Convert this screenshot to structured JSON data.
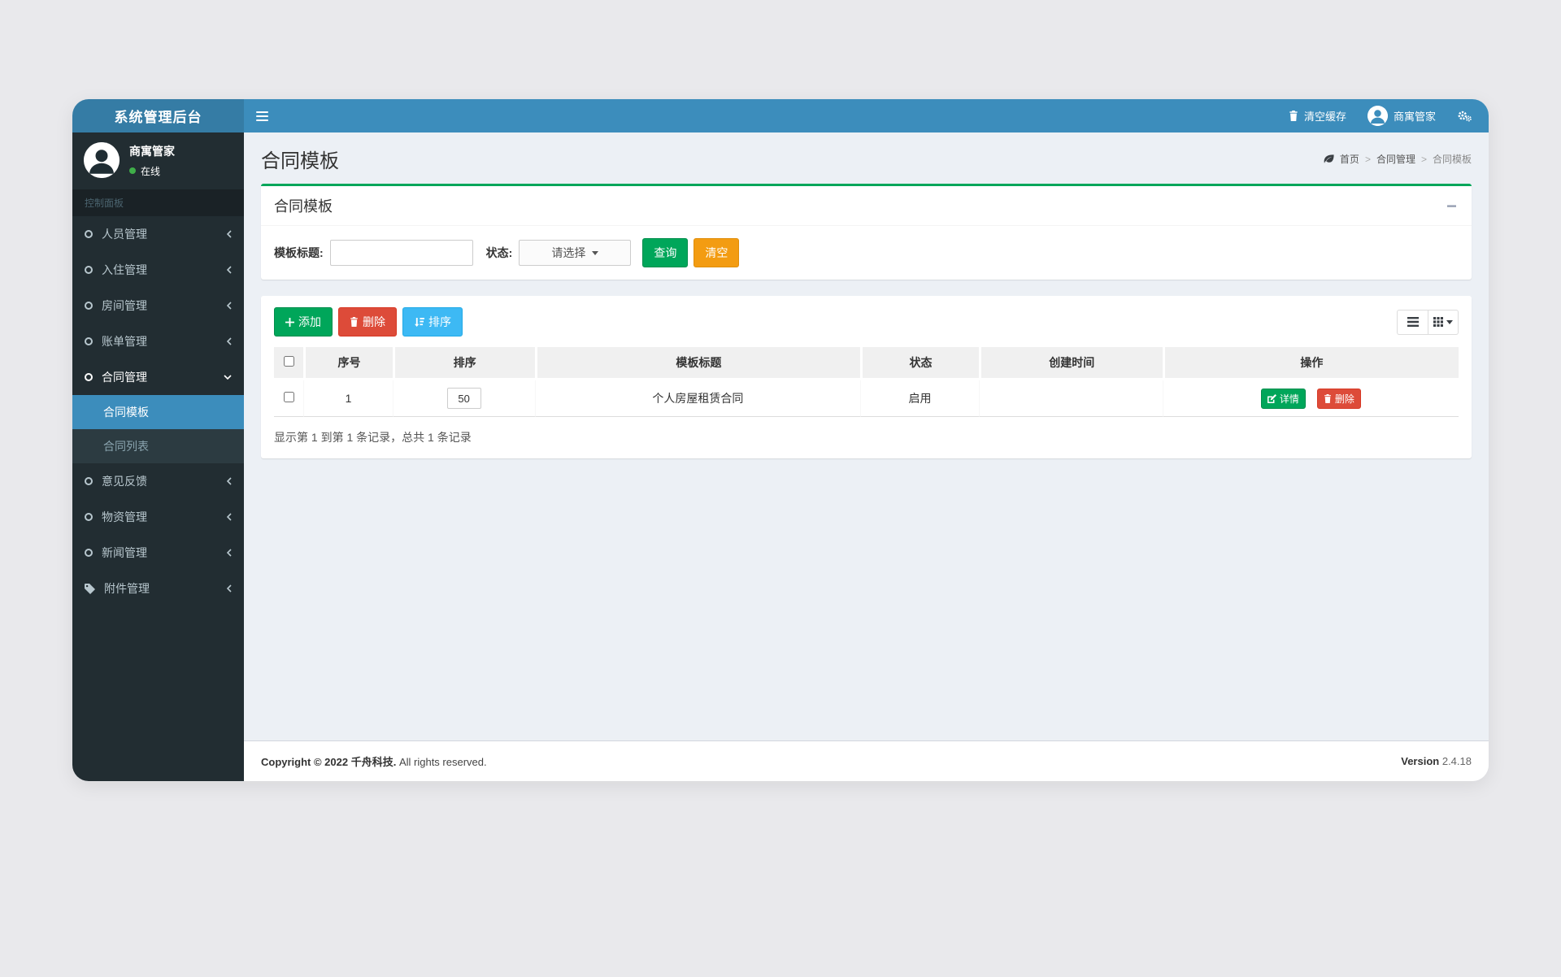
{
  "app": {
    "logo_title": "系统管理后台"
  },
  "navbar": {
    "clear_cache": "清空缓存",
    "user_name": "商寓管家"
  },
  "sidebar": {
    "user_name": "商寓管家",
    "user_status": "在线",
    "section_header": "控制面板",
    "items": [
      {
        "label": "人员管理",
        "icon": "circle-o-icon"
      },
      {
        "label": "入住管理",
        "icon": "circle-o-icon"
      },
      {
        "label": "房间管理",
        "icon": "circle-o-icon"
      },
      {
        "label": "账单管理",
        "icon": "circle-o-icon"
      },
      {
        "label": "合同管理",
        "icon": "circle-o-icon",
        "state": "expanded"
      },
      {
        "label": "意见反馈",
        "icon": "circle-o-icon"
      },
      {
        "label": "物资管理",
        "icon": "circle-o-icon"
      },
      {
        "label": "新闻管理",
        "icon": "circle-o-icon"
      },
      {
        "label": "附件管理",
        "icon": "tag-icon"
      }
    ],
    "submenu": [
      {
        "label": "合同模板",
        "active": true
      },
      {
        "label": "合同列表",
        "active": false
      }
    ]
  },
  "page": {
    "title": "合同模板",
    "breadcrumb": {
      "home": "首页",
      "parent": "合同管理",
      "current": "合同模板",
      "separator": ">"
    }
  },
  "search_panel": {
    "title": "合同模板",
    "template_title_label": "模板标题:",
    "template_title_value": "",
    "status_label": "状态:",
    "status_value": "请选择",
    "search_button": "查询",
    "clear_button": "清空"
  },
  "list_panel": {
    "toolbar": {
      "add": "添加",
      "delete": "删除",
      "sort": "排序"
    },
    "table": {
      "columns": [
        "序号",
        "排序",
        "模板标题",
        "状态",
        "创建时间",
        "操作"
      ],
      "rows": [
        {
          "index": "1",
          "sort_value": "50",
          "title": "个人房屋租赁合同",
          "status": "启用",
          "created_at": "",
          "detail_button": "详情",
          "delete_button": "删除"
        }
      ],
      "summary": "显示第 1 到第 1 条记录，总共 1 条记录"
    }
  },
  "footer": {
    "copyright_strong": "Copyright © 2022 千舟科技.",
    "copyright_rest": "All rights reserved.",
    "version_label": "Version",
    "version_value": "2.4.18"
  },
  "colors": {
    "navbar": "#3c8dbc",
    "logo_bg": "#357ca5",
    "sidebar_bg": "#222d32",
    "submenu_bg": "#2c3b41",
    "active_blue": "#3c8dbc",
    "success": "#00a65a",
    "danger": "#dd4b39",
    "warning": "#f39c12",
    "info": "#3db9f4",
    "content_bg": "#ecf0f5"
  }
}
